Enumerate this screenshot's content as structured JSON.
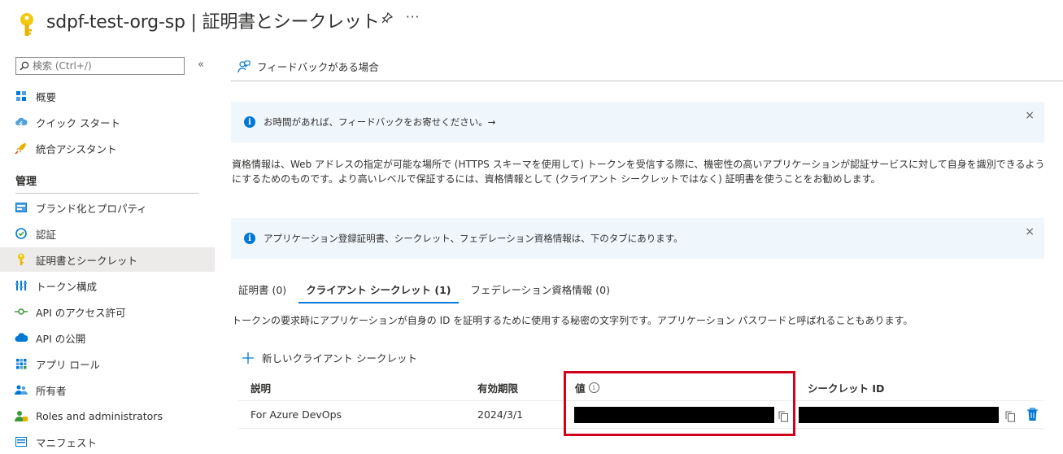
{
  "header": {
    "title": "sdpf-test-org-sp | 証明書とシークレット",
    "pin_icon": "pin-icon",
    "more_icon": "more-icon",
    "more_label": "···"
  },
  "sidebar": {
    "search_placeholder": "検索 (Ctrl+/)",
    "collapse_label": "«",
    "items_top": [
      {
        "label": "概要",
        "icon": "overview-grid-icon"
      },
      {
        "label": "クイック スタート",
        "icon": "cloud-quickstart-icon"
      },
      {
        "label": "統合アシスタント",
        "icon": "rocket-icon"
      }
    ],
    "section_label": "管理",
    "items_manage": [
      {
        "label": "ブランド化とプロパティ",
        "icon": "branding-icon"
      },
      {
        "label": "認証",
        "icon": "authentication-icon"
      },
      {
        "label": "証明書とシークレット",
        "icon": "key-icon",
        "active": true
      },
      {
        "label": "トークン構成",
        "icon": "token-bars-icon"
      },
      {
        "label": "API のアクセス許可",
        "icon": "api-permission-icon"
      },
      {
        "label": "API の公開",
        "icon": "cloud-api-icon"
      },
      {
        "label": "アプリ ロール",
        "icon": "app-roles-grid-icon"
      },
      {
        "label": "所有者",
        "icon": "owners-icon"
      },
      {
        "label": "Roles and administrators",
        "icon": "roles-admins-icon"
      },
      {
        "label": "マニフェスト",
        "icon": "manifest-icon"
      }
    ]
  },
  "main": {
    "feedback_label": "フィードバックがある場合",
    "banner1": {
      "text": "お時間があれば、フィードバックをお寄せください。→",
      "close": "×"
    },
    "description": "資格情報は、Web アドレスの指定が可能な場所で (HTTPS スキーマを使用して) トークンを受信する際に、機密性の高いアプリケーションが認証サービスに対して自身を識別できるようにするためのものです。より高いレベルで保証するには、資格情報として (クライアント シークレットではなく) 証明書を使うことをお勧めします。",
    "banner2": {
      "text": "アプリケーション登録証明書、シークレット、フェデレーション資格情報は、下のタブにあります。",
      "close": "×"
    },
    "tabs": [
      {
        "label": "証明書 (0)",
        "active": false
      },
      {
        "label": "クライアント シークレット (1)",
        "active": true
      },
      {
        "label": "フェデレーション資格情報 (0)",
        "active": false
      }
    ],
    "tab_description": "トークンの要求時にアプリケーションが自身の ID を証明するために使用する秘密の文字列です。アプリケーション パスワードと呼ばれることもあります。",
    "new_secret_label": "新しいクライアント シークレット",
    "table": {
      "columns": [
        "説明",
        "有効期限",
        "値",
        "シークレット ID"
      ],
      "rows": [
        {
          "description": "For Azure DevOps",
          "expires": "2024/3/1"
        }
      ]
    },
    "highlight_color": "#d0021b",
    "accent_color": "#0078d4"
  }
}
